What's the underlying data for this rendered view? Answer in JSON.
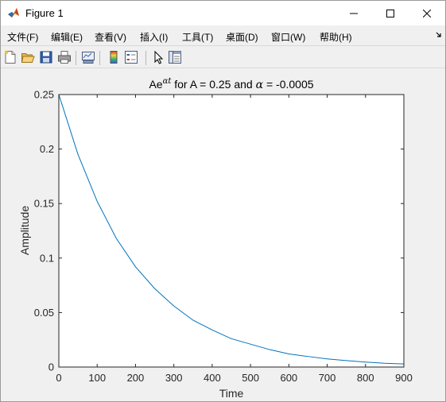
{
  "window": {
    "title": "Figure 1",
    "app_icon": "matlab-logo-icon",
    "controls": {
      "minimize": "minimize-icon",
      "maximize": "maximize-icon",
      "close": "close-icon"
    }
  },
  "menu": [
    {
      "label": "文件(F)"
    },
    {
      "label": "编辑(E)"
    },
    {
      "label": "查看(V)"
    },
    {
      "label": "插入(I)"
    },
    {
      "label": "工具(T)"
    },
    {
      "label": "桌面(D)"
    },
    {
      "label": "窗口(W)"
    },
    {
      "label": "帮助(H)"
    }
  ],
  "toolbar": [
    "new-figure-icon",
    "open-file-icon",
    "save-icon",
    "print-icon",
    "link-plot-icon",
    "insert-colorbar-icon",
    "insert-legend-icon",
    "edit-plot-pointer-icon",
    "property-inspector-icon"
  ],
  "colors": {
    "line": "#0072bd",
    "axes": "#262626",
    "background": "#f0f0f0"
  },
  "chart_data": {
    "type": "line",
    "title_parts": {
      "a": "Ae",
      "sup": "αt",
      "b": " for A = 0.25 and ",
      "alpha": "α",
      "c": " = -0.0005"
    },
    "xlabel": "Time",
    "ylabel": "Amplitude",
    "xlim": [
      0,
      900
    ],
    "ylim": [
      0,
      0.25
    ],
    "xticks": [
      "0",
      "100",
      "200",
      "300",
      "400",
      "500",
      "600",
      "700",
      "800",
      "900"
    ],
    "yticks": [
      "0",
      "0.05",
      "0.1",
      "0.15",
      "0.2",
      "0.25"
    ],
    "grid": false,
    "series": [
      {
        "x": [
          0,
          50,
          100,
          150,
          200,
          250,
          300,
          350,
          400,
          450,
          500,
          550,
          600,
          650,
          700,
          750,
          800,
          850,
          900
        ],
        "values": [
          0.25,
          0.195,
          0.152,
          0.118,
          0.092,
          0.072,
          0.056,
          0.043,
          0.034,
          0.026,
          0.021,
          0.016,
          0.012,
          0.0097,
          0.0075,
          0.0059,
          0.0046,
          0.0035,
          0.0028
        ]
      }
    ]
  }
}
